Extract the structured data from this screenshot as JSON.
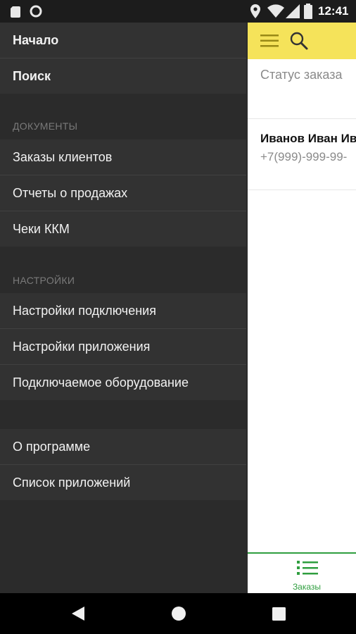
{
  "status_bar": {
    "time": "12:41"
  },
  "drawer": {
    "items_top": [
      {
        "label": "Начало"
      },
      {
        "label": "Поиск"
      }
    ],
    "sections": {
      "documents": "ДОКУМЕНТЫ",
      "settings": "НАСТРОЙКИ"
    },
    "documents_items": [
      {
        "label": "Заказы клиентов"
      },
      {
        "label": "Отчеты о продажах"
      },
      {
        "label": "Чеки ККМ"
      }
    ],
    "settings_items": [
      {
        "label": "Настройки подключения"
      },
      {
        "label": "Настройки приложения"
      },
      {
        "label": "Подключаемое оборудование"
      }
    ],
    "bottom_items": [
      {
        "label": "О программе"
      },
      {
        "label": "Список приложений"
      }
    ]
  },
  "app": {
    "status_label": "Статус заказа",
    "order": {
      "customer_name": "Иванов Иван Ив",
      "phone": "+7(999)-999-99-"
    },
    "tab": {
      "label": "Заказы"
    }
  },
  "colors": {
    "drawer_bg": "#2b2b2b",
    "toolbar": "#f5e35a",
    "accent_green": "#2f9e3f"
  }
}
